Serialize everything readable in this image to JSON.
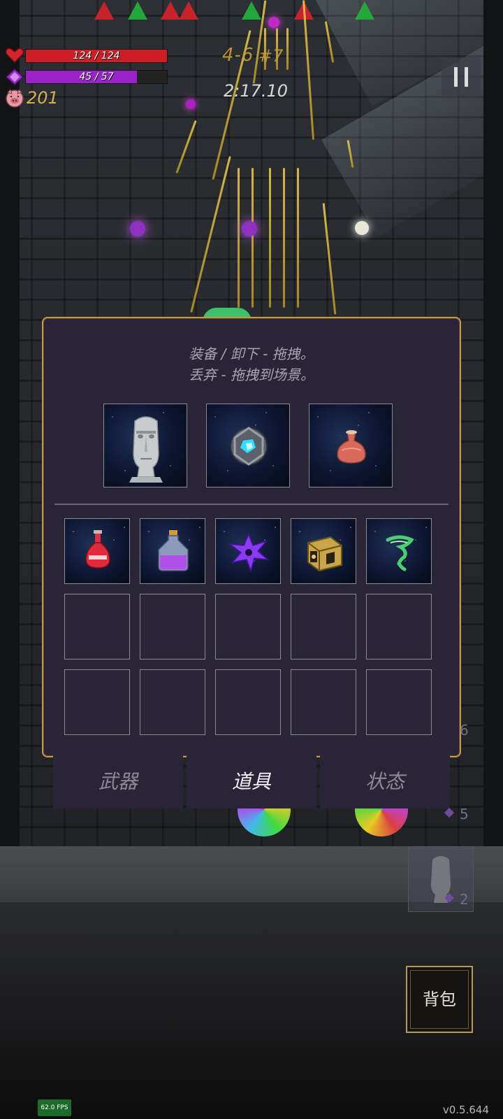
{
  "hud": {
    "hp_text": "124 / 124",
    "hp_fraction": 1.0,
    "mp_text": "45 / 57",
    "mp_fraction": 0.7895,
    "level": "4-6",
    "wave": "#7",
    "timer": "2:17.10",
    "gold": "201"
  },
  "panel": {
    "instruction_line1": "装备 / 卸下 - 拖拽。",
    "instruction_line2": "丢弃 - 拖拽到场景。",
    "equipped": [
      "moai-statue-icon",
      "crystal-core-icon",
      "clay-pot-icon"
    ],
    "inventory": [
      "red-potion-icon",
      "purple-flask-icon",
      "purple-shuriken-icon",
      "golden-box-icon",
      "green-tornado-icon",
      "",
      "",
      "",
      "",
      "",
      "",
      "",
      "",
      "",
      ""
    ]
  },
  "tabs": [
    {
      "label": "武器",
      "active": false
    },
    {
      "label": "道具",
      "active": true
    },
    {
      "label": "状态",
      "active": false
    }
  ],
  "side": {
    "count_6": "6",
    "count_5": "5",
    "count_2": "2"
  },
  "bag_label": "背包",
  "fps": "62.0 FPS",
  "version": "v0.5.644",
  "colors": {
    "hp": "#cc1e24",
    "mp": "#9a22c8",
    "gold": "#d4b04a",
    "panel_border": "#c59a4a",
    "panel_bg": "#2a2438"
  }
}
